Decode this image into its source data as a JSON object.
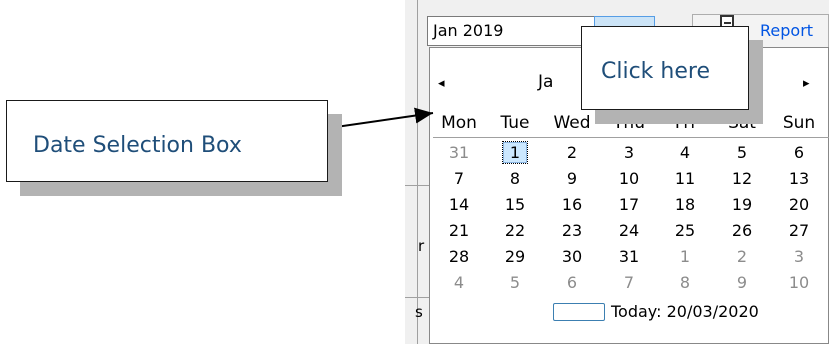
{
  "date_field": {
    "value": "Jan 2019"
  },
  "report_button": {
    "label": "Report",
    "icon": "document-icon"
  },
  "calendar": {
    "month_label": "Ja",
    "prev_icon": "◂",
    "next_icon": "▸",
    "weekdays": [
      "Mon",
      "Tue",
      "Wed",
      "Thu",
      "Fri",
      "Sat",
      "Sun"
    ],
    "weeks": [
      [
        "31",
        "1",
        "2",
        "3",
        "4",
        "5",
        "6"
      ],
      [
        "7",
        "8",
        "9",
        "10",
        "11",
        "12",
        "13"
      ],
      [
        "14",
        "15",
        "16",
        "17",
        "18",
        "19",
        "20"
      ],
      [
        "21",
        "22",
        "23",
        "24",
        "25",
        "26",
        "27"
      ],
      [
        "28",
        "29",
        "30",
        "31",
        "1",
        "2",
        "3"
      ],
      [
        "4",
        "5",
        "6",
        "7",
        "8",
        "9",
        "10"
      ]
    ],
    "selected_day": "1",
    "today_label": "Today: 20/03/2020"
  },
  "background_fragments": {
    "r_fragment": "r",
    "s_fragment": "s"
  },
  "callouts": {
    "left": "Date Selection Box",
    "right": "Click here"
  },
  "colors": {
    "callout_text": "#1f4e79",
    "link_blue": "#0054e3",
    "selection": "#cce8ff"
  }
}
